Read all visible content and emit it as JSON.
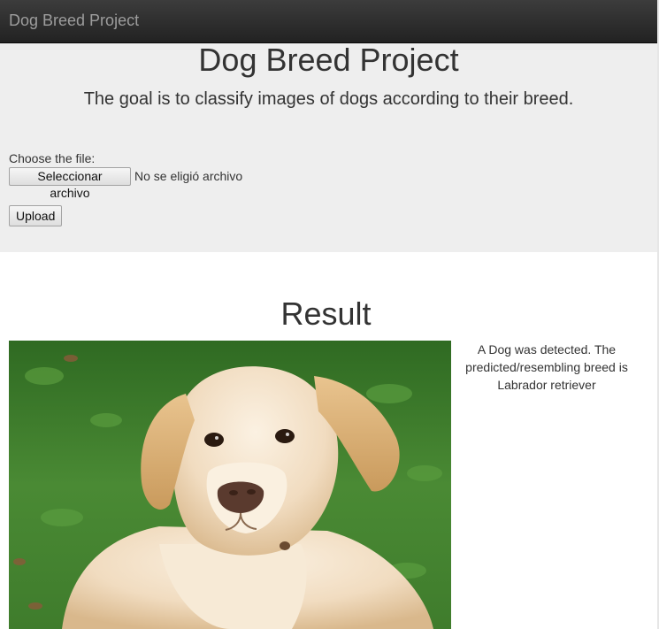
{
  "navbar": {
    "brand": "Dog Breed Project"
  },
  "header": {
    "title": "Dog Breed Project",
    "subtitle": "The goal is to classify images of dogs according to their breed."
  },
  "upload_form": {
    "file_label": "Choose the file:",
    "choose_button_label": "Seleccionar archivo",
    "no_file_text": "No se eligió archivo",
    "upload_button_label": "Upload"
  },
  "result": {
    "title": "Result",
    "message": "A Dog was detected. The predicted/resembling breed is Labrador retriever",
    "image_subject": "labrador-retriever-photo"
  },
  "colors": {
    "navbar_bg": "#222222",
    "jumbotron_bg": "#eeeeee",
    "grass_green": "#3d7a2a",
    "dog_fur": "#f0dcc0"
  }
}
